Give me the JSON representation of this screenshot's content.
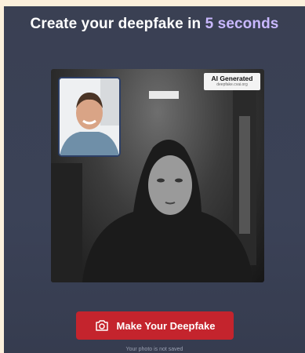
{
  "header": {
    "title_prefix": "Create your deepfake in ",
    "title_highlight": "5 seconds"
  },
  "preview": {
    "badge_title": "AI Generated",
    "badge_subtitle": "deepfake.cvai.org",
    "main_image": "generated-deepfake-portrait",
    "inset_image": "source-selfie-thumbnail"
  },
  "cta": {
    "label": "Make Your Deepfake",
    "icon": "camera-icon"
  },
  "footer": {
    "note": "Your photo is not saved"
  },
  "colors": {
    "page_bg": "#fbf0dc",
    "panel_bg": "#3a4053",
    "accent_text": "#c9b8ff",
    "button_bg": "#c4242d"
  }
}
